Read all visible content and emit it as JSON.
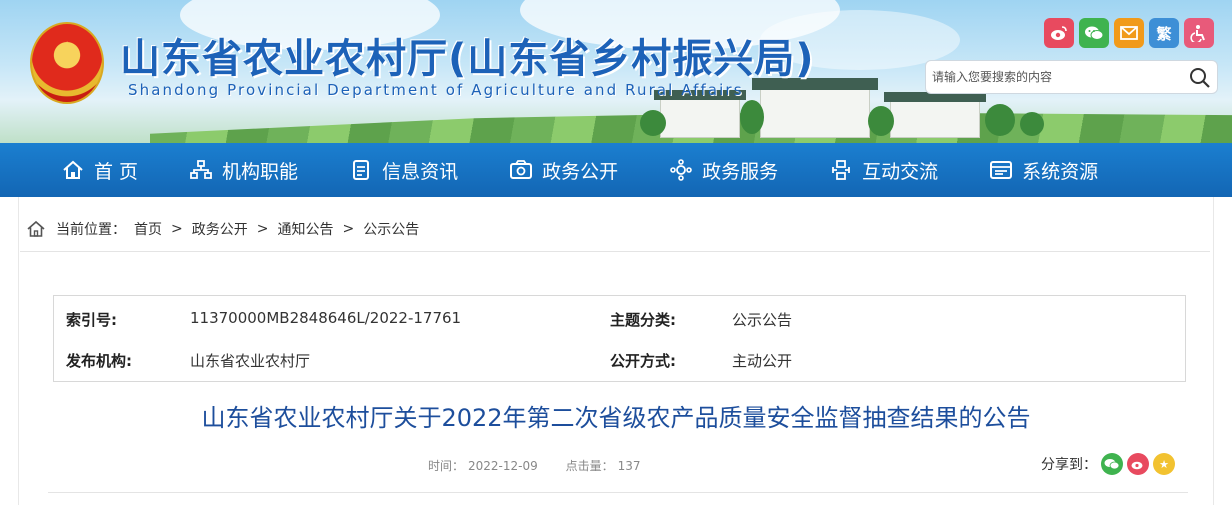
{
  "header": {
    "title": "山东省农业农村厅(山东省乡村振兴局)",
    "subtitle": "Shandong Provincial Department of Agriculture and Rural Affairs",
    "search_placeholder": "请输入您要搜索的内容",
    "quick_links": [
      {
        "icon": "weibo-icon",
        "color": "#e84a5f"
      },
      {
        "icon": "wechat-icon",
        "color": "#3fb34f"
      },
      {
        "icon": "mail-icon",
        "color": "#f19a1a"
      },
      {
        "icon": "traditional-chinese-icon",
        "label": "繁",
        "color": "#3d8fd6"
      },
      {
        "icon": "accessibility-icon",
        "color": "#e85a7a"
      }
    ]
  },
  "nav": {
    "items": [
      {
        "label": "首 页",
        "icon": "home-icon"
      },
      {
        "label": "机构职能",
        "icon": "organization-icon"
      },
      {
        "label": "信息资讯",
        "icon": "document-icon"
      },
      {
        "label": "政务公开",
        "icon": "disclosure-icon"
      },
      {
        "label": "政务服务",
        "icon": "service-icon"
      },
      {
        "label": "互动交流",
        "icon": "interaction-icon"
      },
      {
        "label": "系统资源",
        "icon": "system-icon"
      }
    ]
  },
  "breadcrumb": {
    "prefix": "当前位置：",
    "items": [
      "首页",
      "政务公开",
      "通知公告",
      "公示公告"
    ],
    "separator": ">"
  },
  "meta": {
    "index_label": "索引号:",
    "index_value": "11370000MB2848646L/2022-17761",
    "topic_label": "主题分类:",
    "topic_value": "公示公告",
    "publisher_label": "发布机构:",
    "publisher_value": "山东省农业农村厅",
    "disclosure_label": "公开方式:",
    "disclosure_value": "主动公开"
  },
  "article": {
    "title": "山东省农业农村厅关于2022年第二次省级农产品质量安全监督抽查结果的公告",
    "time_label": "时间：",
    "time_value": "2022-12-09",
    "views_label": "点击量：",
    "views_value": "137",
    "share_label": "分享到："
  },
  "colors": {
    "brand_blue": "#1d62b8",
    "nav_blue": "#1572c4",
    "title_blue": "#1d4e9c"
  }
}
